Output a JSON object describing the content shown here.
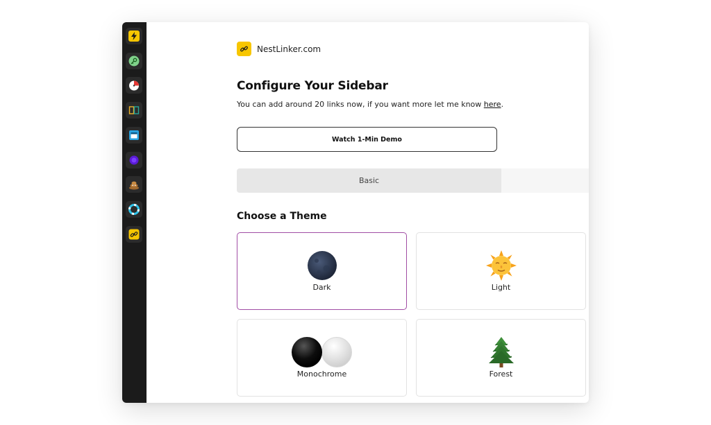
{
  "brand": {
    "name": "NestLinker.com",
    "logo_icon": "link-icon",
    "color": "#f7c600"
  },
  "header": {
    "title": "Configure Your Sidebar",
    "subtitle_prefix": "You can add around 20 links now, if you want more let me know ",
    "subtitle_link": "here",
    "subtitle_suffix": "."
  },
  "demo_button": {
    "label": "Watch 1-Min Demo"
  },
  "tabs": [
    {
      "label": "Basic",
      "active": true
    },
    {
      "label": "",
      "active": false
    }
  ],
  "themes": {
    "title": "Choose a Theme",
    "accent": "#a04ca4",
    "items": [
      {
        "label": "Dark",
        "icon": "new-moon-icon",
        "selected": true
      },
      {
        "label": "Light",
        "icon": "sun-face-icon",
        "selected": false
      },
      {
        "label": "Monochrome",
        "icon": "black-white-circles-icon",
        "selected": false
      },
      {
        "label": "Forest",
        "icon": "evergreen-tree-icon",
        "selected": false
      }
    ]
  },
  "rail": {
    "background": "#1b1b1b",
    "items": [
      {
        "icon": "lightning-icon"
      },
      {
        "icon": "key-icon"
      },
      {
        "icon": "timer-icon"
      },
      {
        "icon": "book-icon"
      },
      {
        "icon": "window-icon"
      },
      {
        "icon": "purple-orb-icon"
      },
      {
        "icon": "pile-icon"
      },
      {
        "icon": "lifebuoy-icon"
      },
      {
        "icon": "link-icon"
      }
    ]
  }
}
